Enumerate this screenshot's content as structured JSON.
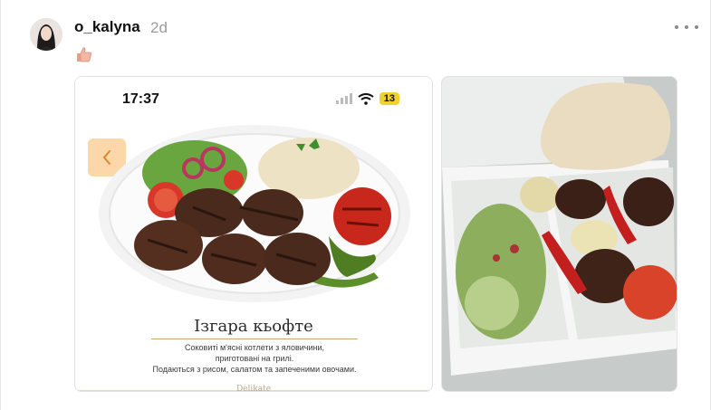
{
  "post": {
    "username": "o_kalyna",
    "timestamp": "2d",
    "reaction_emoji": "thumbs-up"
  },
  "menu_screenshot": {
    "status_time": "17:37",
    "battery": "13",
    "dish_title": "Ізгара кьофте",
    "description_lines": [
      "Соковиті м'ясні котлети з яловичини,",
      "приготовані на грилі.",
      "Подаються з рисом, салатом та запеченими овочами."
    ],
    "brand": "Delikate"
  },
  "icons": [
    "avatar",
    "more-options-icon",
    "thumbs-up-icon",
    "signal-icon",
    "wifi-icon",
    "battery-icon",
    "chevron-left-icon"
  ],
  "colors": {
    "accent": "#f2d12e",
    "back_button": "#fbd7a9",
    "rule": "#c9a873"
  }
}
